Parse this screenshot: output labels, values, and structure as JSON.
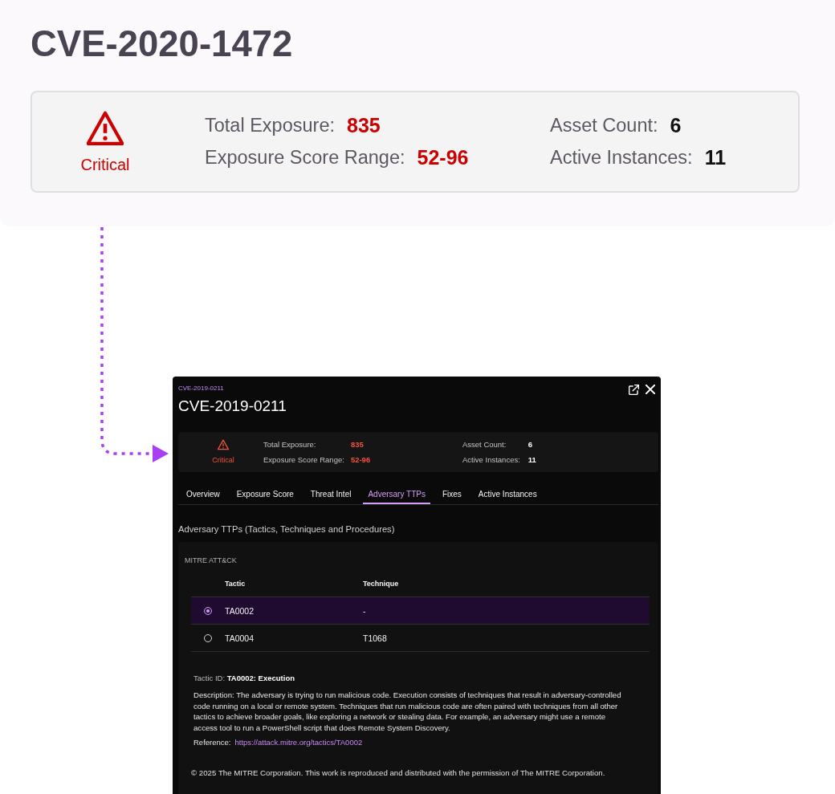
{
  "header": {
    "title": "CVE-2020-1472",
    "summary": {
      "severity": "Critical",
      "columns": [
        [
          {
            "label": "Total Exposure:",
            "value": "835",
            "kind": "score"
          },
          {
            "label": "Exposure Score Range:",
            "value": "52-96",
            "kind": "score"
          }
        ],
        [
          {
            "label": "Asset Count:",
            "value": "6",
            "kind": "count"
          },
          {
            "label": "Active Instances:",
            "value": "11",
            "kind": "count"
          }
        ]
      ]
    }
  },
  "panel": {
    "breadcrumb": "CVE-2019-0211",
    "title": "CVE-2019-0211",
    "summary": {
      "severity": "Critical",
      "columns": [
        [
          {
            "label": "Total Exposure:",
            "value": "835",
            "kind": "score"
          },
          {
            "label": "Exposure Score Range:",
            "value": "52-96",
            "kind": "score"
          }
        ],
        [
          {
            "label": "Asset Count:",
            "value": "6",
            "kind": "count"
          },
          {
            "label": "Active Instances:",
            "value": "11",
            "kind": "count"
          }
        ]
      ]
    },
    "tabs": [
      {
        "label": "Overview",
        "selected": false
      },
      {
        "label": "Exposure Score",
        "selected": false
      },
      {
        "label": "Threat Intel",
        "selected": false
      },
      {
        "label": "Adversary TTPs",
        "selected": true
      },
      {
        "label": "Fixes",
        "selected": false
      },
      {
        "label": "Active Instances",
        "selected": false
      }
    ],
    "section_title": "Adversary TTPs (Tactics, Techniques and Procedures)",
    "mitre": {
      "title": "MITRE ATT&CK",
      "columns": [
        "Tactic",
        "Technique"
      ],
      "rows": [
        {
          "selected": true,
          "tactic": "TA0002",
          "technique": "-"
        },
        {
          "selected": false,
          "tactic": "TA0004",
          "technique": "T1068"
        }
      ],
      "tactic_id": "Tactic ID: **TA0002: Execution**",
      "description": "Description: The adversary is trying to run malicious code. Execution consists of techniques that result in adversary-controlled code running on a local or remote system. Techniques that run malicious code are often paired with techniques from all other tactics to achieve broader goals, like exploring a network or stealing data. For example, an adversary might use a remote access tool to run a PowerShell script that does Remote System Discovery.",
      "reference": {
        "label": "Reference:",
        "url": "https://attack.mitre.org/tactics/TA0002"
      },
      "copyright": "© 2025 The MITRE Corporation. This work is reproduced and distributed with the permission of The MITRE Corporation."
    }
  }
}
